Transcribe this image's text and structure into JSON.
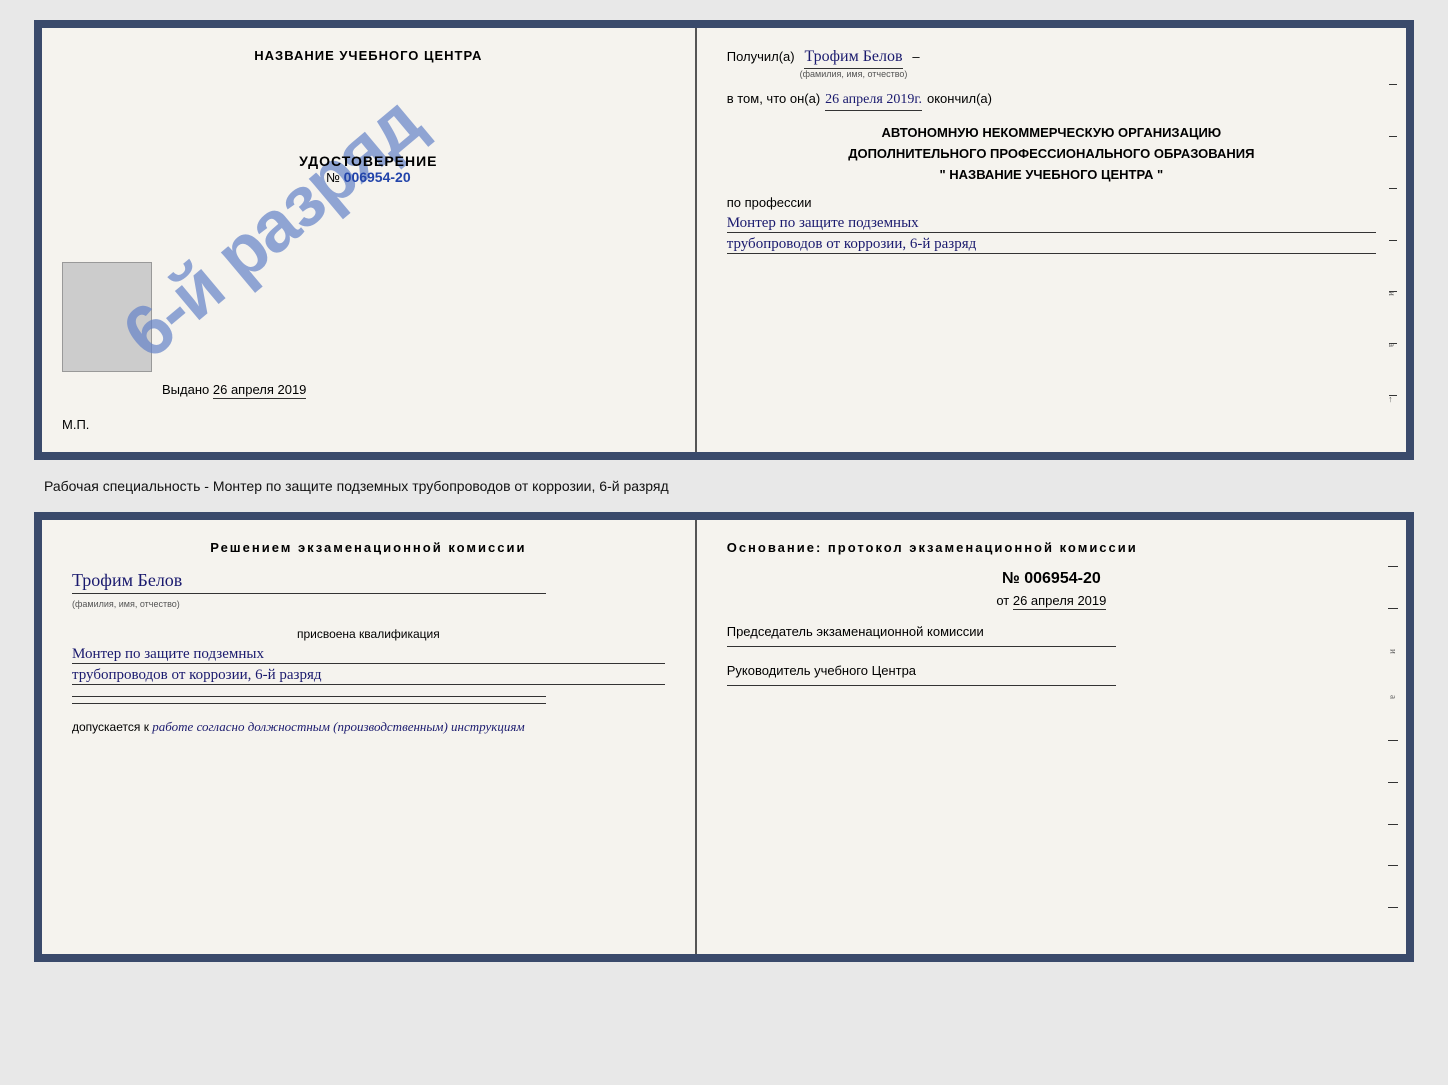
{
  "top_cert": {
    "left": {
      "school_name": "НАЗВАНИЕ УЧЕБНОГО ЦЕНТРА",
      "stamp_text": "6-й разряд",
      "cert_title": "УДОСТОВЕРЕНИЕ",
      "cert_no_label": "№",
      "cert_no": "006954-20",
      "issued_label": "Выдано",
      "issued_date": "26 апреля 2019",
      "mp_label": "М.П."
    },
    "right": {
      "received_label": "Получил(а)",
      "recipient_name": "Трофим Белов",
      "recipient_sublabel": "(фамилия, имя, отчество)",
      "dash": "–",
      "in_that_label": "в том, что он(а)",
      "completed_date": "26 апреля 2019г.",
      "completed_label": "окончил(а)",
      "org_line1": "АВТОНОМНУЮ НЕКОММЕРЧЕСКУЮ ОРГАНИЗАЦИЮ",
      "org_line2": "ДОПОЛНИТЕЛЬНОГО ПРОФЕССИОНАЛЬНОГО ОБРАЗОВАНИЯ",
      "org_line3": "\"   НАЗВАНИЕ УЧЕБНОГО ЦЕНТРА   \"",
      "profession_label": "по профессии",
      "profession_line1": "Монтер по защите подземных",
      "profession_line2": "трубопроводов от коррозии, 6-й разряд"
    }
  },
  "specialty_text": "Рабочая специальность - Монтер по защите подземных трубопроводов от коррозии, 6-й разряд",
  "bottom_cert": {
    "left": {
      "decision_header": "Решением  экзаменационной  комиссии",
      "name": "Трофим Белов",
      "name_sublabel": "(фамилия, имя, отчество)",
      "assigned_label": "присвоена квалификация",
      "qualification_line1": "Монтер по защите подземных",
      "qualification_line2": "трубопроводов от коррозии, 6-й разряд",
      "allowed_label": "допускается к",
      "allowed_handwritten": "работе согласно должностным (производственным) инструкциям"
    },
    "right": {
      "basis_header": "Основание:  протокол  экзаменационной  комиссии",
      "protocol_no": "№  006954-20",
      "from_label": "от",
      "from_date": "26 апреля 2019",
      "committee_head_label": "Председатель экзаменационной комиссии",
      "director_label": "Руководитель учебного Центра"
    }
  },
  "decorative": {
    "right_chars": [
      "и",
      "а",
      "←",
      "–",
      "–",
      "–",
      "–"
    ]
  }
}
